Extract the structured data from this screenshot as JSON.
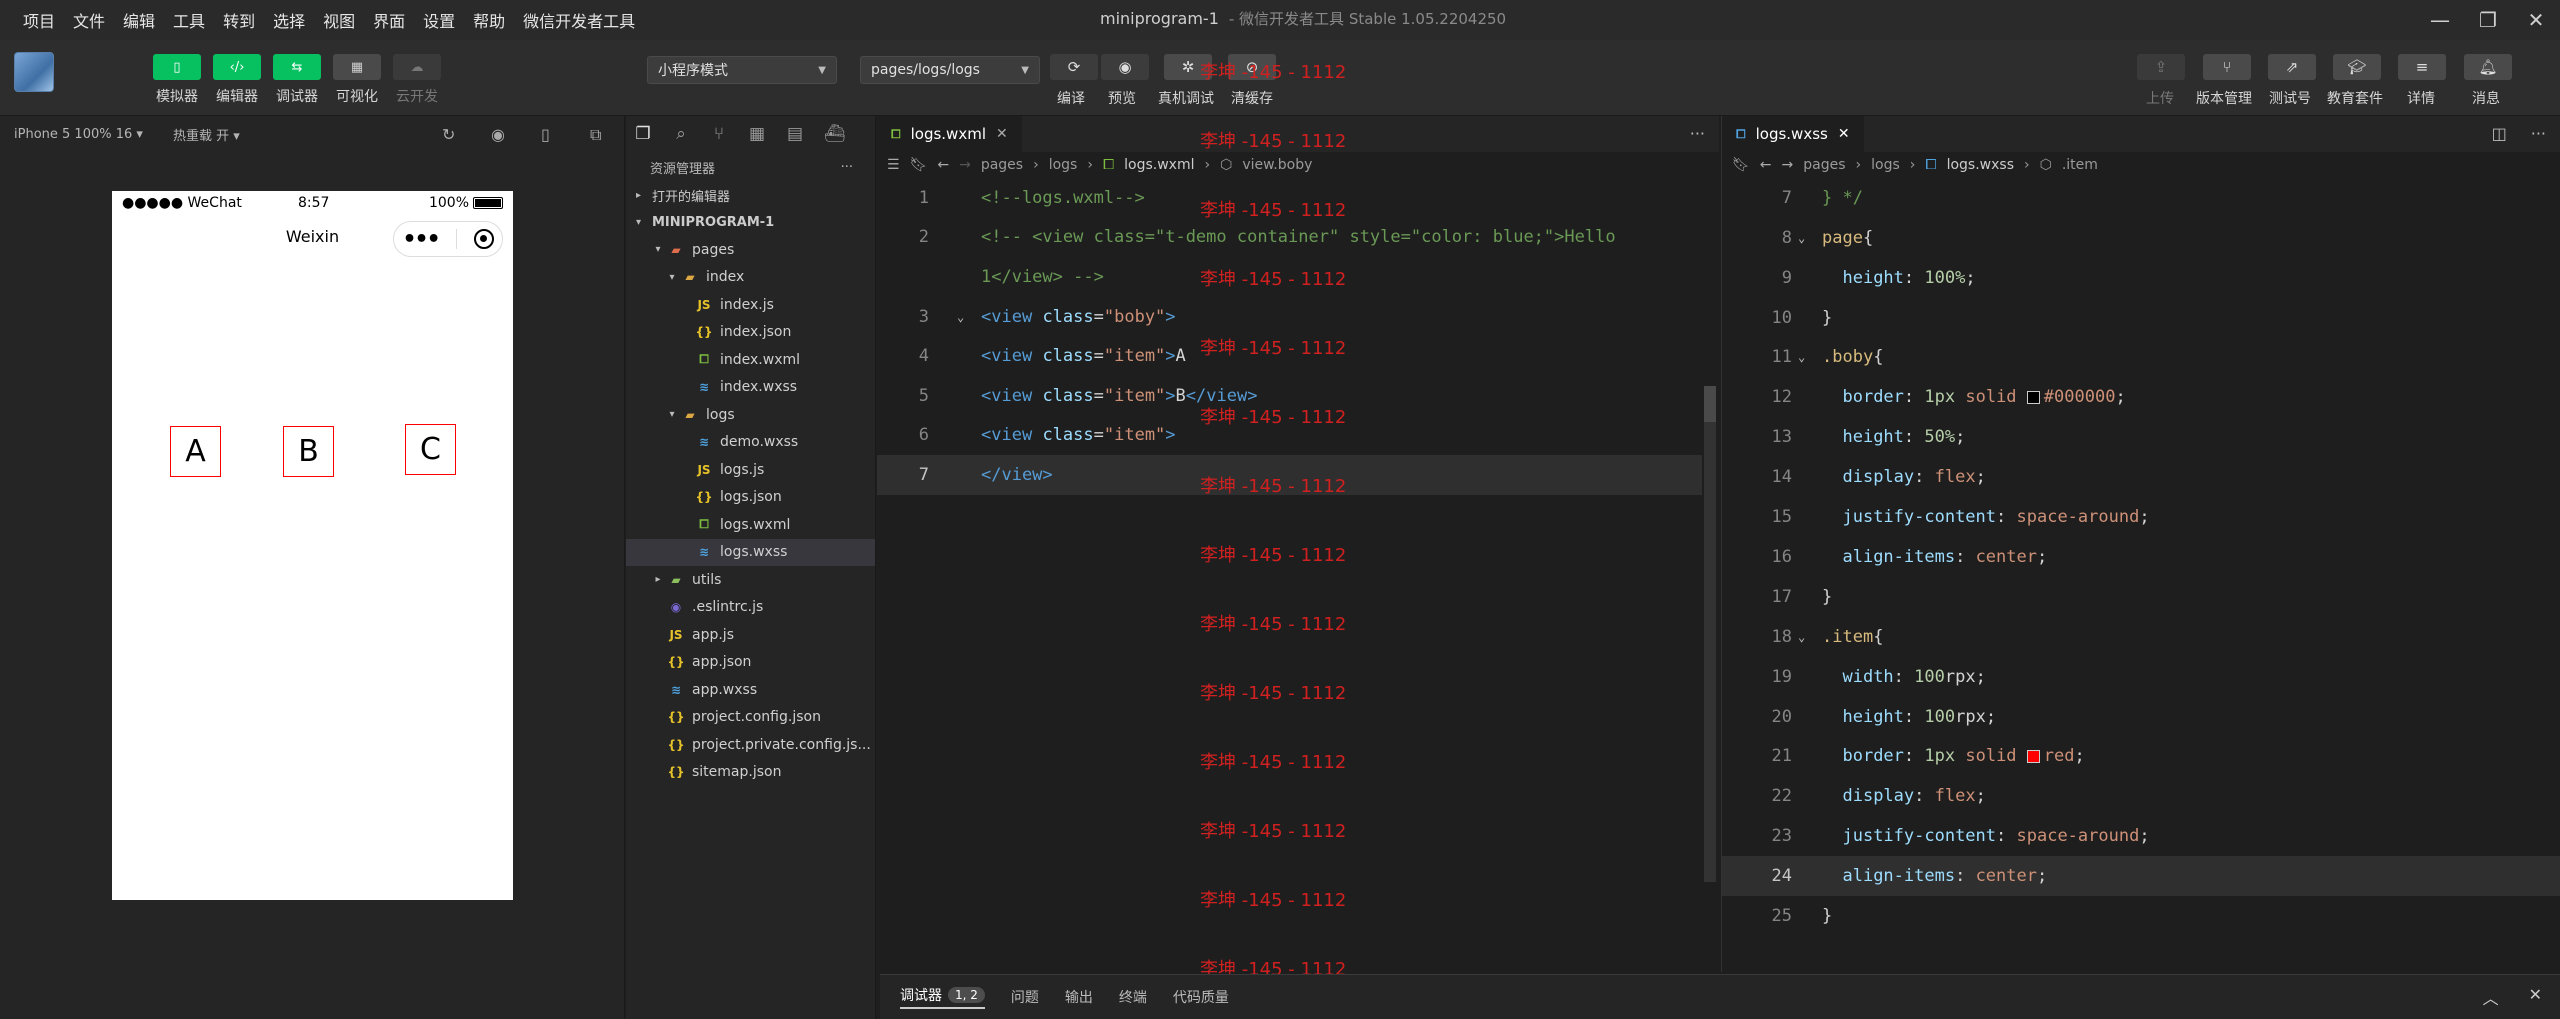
{
  "menubar": {
    "items": [
      "项目",
      "文件",
      "编辑",
      "工具",
      "转到",
      "选择",
      "视图",
      "界面",
      "设置",
      "帮助",
      "微信开发者工具"
    ],
    "window_title": "miniprogram-1",
    "window_subtitle": "- 微信开发者工具 Stable 1.05.2204250"
  },
  "toolbar": {
    "left_buttons": [
      {
        "label": "模拟器",
        "icon": "phone-icon"
      },
      {
        "label": "编辑器",
        "icon": "code-icon"
      },
      {
        "label": "调试器",
        "icon": "debug-icon"
      },
      {
        "label": "可视化",
        "icon": "layout-icon"
      },
      {
        "label": "云开发",
        "icon": "cloud-icon"
      }
    ],
    "mode_select": "小程序模式",
    "page_select": "pages/logs/logs",
    "mid_labels": {
      "compile": "编译",
      "preview": "预览",
      "remote_debug": "真机调试",
      "clear_cache": "清缓存"
    },
    "right_labels": {
      "upload": "上传",
      "version": "版本管理",
      "test": "测试号",
      "edu": "教育套件",
      "detail": "详情",
      "message": "消息"
    }
  },
  "simulator": {
    "device": "iPhone 5 100% 16",
    "hot_reload": "热重载 开",
    "status_carrier": "●●●●● WeChat",
    "status_time": "8:57",
    "status_battery": "100%",
    "nav_title": "Weixin",
    "items": [
      "A",
      "B",
      "C"
    ]
  },
  "explorer": {
    "title": "资源管理器",
    "open_editors": "打开的编辑器",
    "project": "MINIPROGRAM-1",
    "tree": [
      {
        "name": "pages",
        "type": "folder-red",
        "depth": 1,
        "twisty": "▾"
      },
      {
        "name": "index",
        "type": "folder",
        "depth": 2,
        "twisty": "▾"
      },
      {
        "name": "index.js",
        "type": "js",
        "depth": 3
      },
      {
        "name": "index.json",
        "type": "json",
        "depth": 3
      },
      {
        "name": "index.wxml",
        "type": "wxml",
        "depth": 3
      },
      {
        "name": "index.wxss",
        "type": "wxss",
        "depth": 3
      },
      {
        "name": "logs",
        "type": "folder",
        "depth": 2,
        "twisty": "▾"
      },
      {
        "name": "demo.wxss",
        "type": "wxss",
        "depth": 3
      },
      {
        "name": "logs.js",
        "type": "js",
        "depth": 3
      },
      {
        "name": "logs.json",
        "type": "json",
        "depth": 3
      },
      {
        "name": "logs.wxml",
        "type": "wxml",
        "depth": 3
      },
      {
        "name": "logs.wxss",
        "type": "wxss",
        "depth": 3,
        "selected": true
      },
      {
        "name": "utils",
        "type": "folder-green",
        "depth": 1,
        "twisty": "▸"
      },
      {
        "name": ".eslintrc.js",
        "type": "eslint",
        "depth": 1
      },
      {
        "name": "app.js",
        "type": "js",
        "depth": 1
      },
      {
        "name": "app.json",
        "type": "json",
        "depth": 1
      },
      {
        "name": "app.wxss",
        "type": "wxss",
        "depth": 1
      },
      {
        "name": "project.config.json",
        "type": "json",
        "depth": 1
      },
      {
        "name": "project.private.config.js...",
        "type": "json",
        "depth": 1
      },
      {
        "name": "sitemap.json",
        "type": "json",
        "depth": 1
      }
    ]
  },
  "editor_left": {
    "tab": "logs.wxml",
    "breadcrumb": [
      "pages",
      "logs",
      "logs.wxml",
      "view.boby"
    ],
    "lines": [
      {
        "n": "1",
        "html": "<span class='tk-cm'>&lt;!--logs.wxml--&gt;</span>"
      },
      {
        "n": "2",
        "html": "<span class='tk-cm'>&lt;!-- &lt;view class=\"t-demo container\" style=\"color: blue;\"&gt;Hello</span>"
      },
      {
        "n": "",
        "html": "<span class='tk-cm'>1&lt;/view&gt; --&gt;</span>"
      },
      {
        "n": "3",
        "html": "<span class='tk-tag'>&lt;view</span> <span class='tk-attr'>class</span><span class='tk-txt'>=</span><span class='tk-str'>\"boby\"</span><span class='tk-tag'>&gt;</span>",
        "fold": true
      },
      {
        "n": "4",
        "html": "<span class='tk-tag'>&lt;view</span> <span class='tk-attr'>class</span><span class='tk-txt'>=</span><span class='tk-str'>\"item\"</span><span class='tk-tag'>&gt;</span><span class='tk-txt'>A</span>"
      },
      {
        "n": "5",
        "html": "<span class='tk-tag'>&lt;view</span> <span class='tk-attr'>class</span><span class='tk-txt'>=</span><span class='tk-str'>\"item\"</span><span class='tk-tag'>&gt;</span><span class='tk-txt'>B</span><span class='tk-tag'>&lt;/view&gt;</span>"
      },
      {
        "n": "6",
        "html": "<span class='tk-tag'>&lt;view</span> <span class='tk-attr'>class</span><span class='tk-txt'>=</span><span class='tk-str'>\"item\"</span><span class='tk-tag'>&gt;</span>"
      },
      {
        "n": "7",
        "html": "<span class='tk-tag'>&lt;/view&gt;</span>",
        "active": true
      }
    ]
  },
  "editor_right": {
    "tab": "logs.wxss",
    "breadcrumb": [
      "pages",
      "logs",
      "logs.wxss",
      ".item"
    ],
    "lines": [
      {
        "n": "7",
        "html": "<span class='tk-cm'>} */</span>"
      },
      {
        "n": "8",
        "html": "<span class='tk-sel'>page</span><span class='tk-punc'>{</span>",
        "fold": true
      },
      {
        "n": "9",
        "html": "  <span class='tk-prop'>height</span><span class='tk-punc'>: </span><span class='tk-num'>100%</span><span class='tk-punc'>;</span>"
      },
      {
        "n": "10",
        "html": "<span class='tk-punc'>}</span>"
      },
      {
        "n": "11",
        "html": "<span class='tk-sel'>.boby</span><span class='tk-punc'>{</span>",
        "fold": true
      },
      {
        "n": "12",
        "html": "  <span class='tk-prop'>border</span><span class='tk-punc'>: </span><span class='tk-num'>1px</span> <span class='tk-val'>solid</span> <span class='swatch' style='background:#000000'></span><span class='tk-val'>#000000</span><span class='tk-punc'>;</span>"
      },
      {
        "n": "13",
        "html": "  <span class='tk-prop'>height</span><span class='tk-punc'>: </span><span class='tk-num'>50%</span><span class='tk-punc'>;</span>"
      },
      {
        "n": "14",
        "html": "  <span class='tk-prop'>display</span><span class='tk-punc'>: </span><span class='tk-val'>flex</span><span class='tk-punc'>;</span>"
      },
      {
        "n": "15",
        "html": "  <span class='tk-prop'>justify-content</span><span class='tk-punc'>: </span><span class='tk-val'>space-around</span><span class='tk-punc'>;</span>"
      },
      {
        "n": "16",
        "html": "  <span class='tk-prop'>align-items</span><span class='tk-punc'>: </span><span class='tk-val'>center</span><span class='tk-punc'>;</span>"
      },
      {
        "n": "17",
        "html": "<span class='tk-punc'>}</span>"
      },
      {
        "n": "18",
        "html": "<span class='tk-sel'>.item</span><span class='tk-punc'>{</span>",
        "fold": true
      },
      {
        "n": "19",
        "html": "  <span class='tk-prop'>width</span><span class='tk-punc'>: </span><span class='tk-num'>100</span><span class='tk-punc'>rpx;</span>"
      },
      {
        "n": "20",
        "html": "  <span class='tk-prop'>height</span><span class='tk-punc'>: </span><span class='tk-num'>100</span><span class='tk-punc'>rpx;</span>"
      },
      {
        "n": "21",
        "html": "  <span class='tk-prop'>border</span><span class='tk-punc'>: </span><span class='tk-num'>1px</span> <span class='tk-val'>solid</span> <span class='swatch' style='background:#ff0000'></span><span class='tk-val'>red</span><span class='tk-punc'>;</span>"
      },
      {
        "n": "22",
        "html": "  <span class='tk-prop'>display</span><span class='tk-punc'>: </span><span class='tk-val'>flex</span><span class='tk-punc'>;</span>"
      },
      {
        "n": "23",
        "html": "  <span class='tk-prop'>justify-content</span><span class='tk-punc'>: </span><span class='tk-val'>space-around</span><span class='tk-punc'>;</span>"
      },
      {
        "n": "24",
        "html": "  <span class='tk-prop'>align-items</span><span class='tk-punc'>: </span><span class='tk-val'>center</span><span class='tk-punc'>;</span>",
        "active": true
      },
      {
        "n": "25",
        "html": "<span class='tk-punc'>}</span>"
      }
    ]
  },
  "watermark": "李坤 -145 - 1112",
  "bottom_panel": {
    "tabs": [
      "调试器",
      "问题",
      "输出",
      "终端",
      "代码质量"
    ],
    "badge": "1, 2"
  },
  "colors": {
    "accent_green": "#07c160",
    "item_border": "#ff0000"
  }
}
